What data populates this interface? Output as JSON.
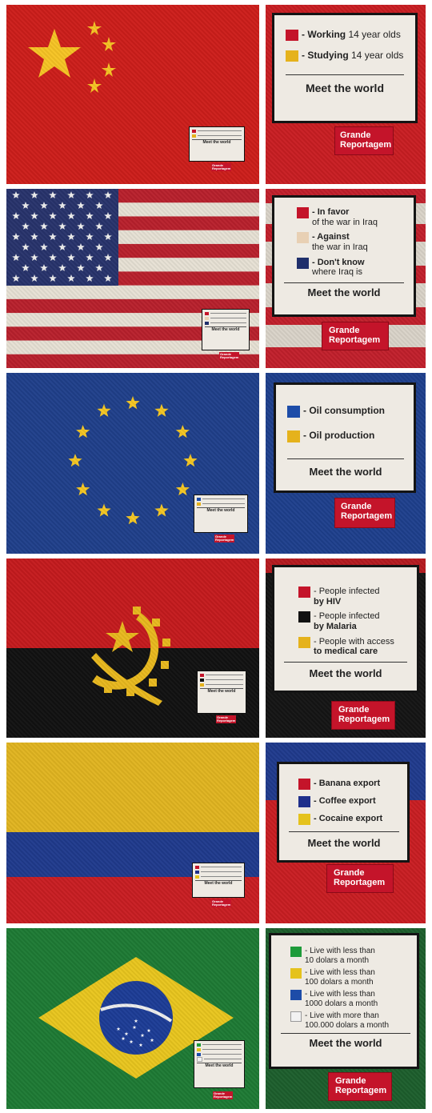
{
  "badge": {
    "line1": "Grande",
    "line2": "Reportagem"
  },
  "meet": "Meet the world",
  "panels": {
    "china": {
      "items": [
        {
          "color": "#c4142a",
          "label": "- Working",
          "sub": " 14 year olds"
        },
        {
          "color": "#e5b21c",
          "label": "- Studying",
          "sub": " 14 year olds"
        }
      ]
    },
    "usa": {
      "items": [
        {
          "color": "#c4142a",
          "label": "- In favor",
          "sub": "of the war in Iraq"
        },
        {
          "color": "#e8d0b4",
          "label": "- Against",
          "sub": "the war in Iraq"
        },
        {
          "color": "#1f2f6b",
          "label": "- Don't know",
          "sub": "where Iraq is"
        }
      ]
    },
    "eu": {
      "items": [
        {
          "color": "#1d4ca8",
          "label": "- Oil consumption",
          "sub": ""
        },
        {
          "color": "#e5b21c",
          "label": "- Oil production",
          "sub": ""
        }
      ]
    },
    "angola": {
      "items": [
        {
          "color": "#c4142a",
          "label": "- People infected",
          "sub": "by HIV"
        },
        {
          "color": "#111111",
          "label": "- People infected",
          "sub": "by Malaria"
        },
        {
          "color": "#e5b21c",
          "label": "- People with access",
          "sub": "to medical care"
        }
      ]
    },
    "colombia": {
      "items": [
        {
          "color": "#c4142a",
          "label": "- Banana export",
          "sub": ""
        },
        {
          "color": "#1f2f8b",
          "label": "- Coffee export",
          "sub": ""
        },
        {
          "color": "#e5c21c",
          "label": "- Cocaine export",
          "sub": ""
        }
      ]
    },
    "brazil": {
      "items": [
        {
          "color": "#1e9b3a",
          "label": "- Live with less than",
          "sub": "10 dolars a month"
        },
        {
          "color": "#e5c21c",
          "label": "- Live with less than",
          "sub": "100 dolars a month"
        },
        {
          "color": "#1d4ca8",
          "label": "- Live with less than",
          "sub": "1000 dolars a month"
        },
        {
          "color": "#f2f2f2",
          "label": "- Live with more than",
          "sub": "100.000 dolars a month"
        }
      ]
    }
  }
}
